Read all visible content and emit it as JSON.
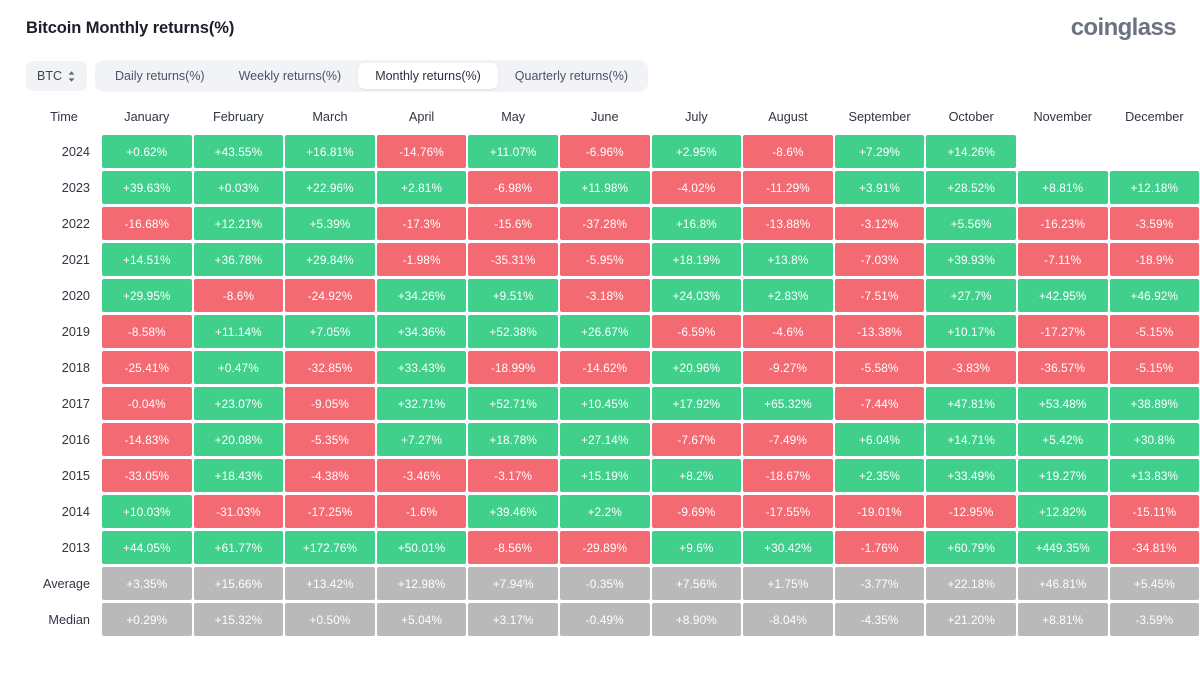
{
  "header": {
    "title": "Bitcoin Monthly returns(%)",
    "brand": "coinglass"
  },
  "controls": {
    "asset": "BTC",
    "asset_icon": "chevron-up-down-icon",
    "tabs": [
      {
        "label": "Daily returns(%)",
        "active": false
      },
      {
        "label": "Weekly returns(%)",
        "active": false
      },
      {
        "label": "Monthly returns(%)",
        "active": true
      },
      {
        "label": "Quarterly returns(%)",
        "active": false
      }
    ]
  },
  "colors": {
    "positive": "#41cf8c",
    "negative": "#f46a72",
    "statistic": "#b9b9b9",
    "tab_bar": "#f1f3f7",
    "text_dark": "#2f3542"
  },
  "table": {
    "columns": [
      "Time",
      "January",
      "February",
      "March",
      "April",
      "May",
      "June",
      "July",
      "August",
      "September",
      "October",
      "November",
      "December"
    ],
    "rows": [
      {
        "label": "2024",
        "type": "year",
        "values": [
          "+0.62%",
          "+43.55%",
          "+16.81%",
          "-14.76%",
          "+11.07%",
          "-6.96%",
          "+2.95%",
          "-8.6%",
          "+7.29%",
          "+14.26%",
          "",
          ""
        ]
      },
      {
        "label": "2023",
        "type": "year",
        "values": [
          "+39.63%",
          "+0.03%",
          "+22.96%",
          "+2.81%",
          "-6.98%",
          "+11.98%",
          "-4.02%",
          "-11.29%",
          "+3.91%",
          "+28.52%",
          "+8.81%",
          "+12.18%"
        ]
      },
      {
        "label": "2022",
        "type": "year",
        "values": [
          "-16.68%",
          "+12.21%",
          "+5.39%",
          "-17.3%",
          "-15.6%",
          "-37.28%",
          "+16.8%",
          "-13.88%",
          "-3.12%",
          "+5.56%",
          "-16.23%",
          "-3.59%"
        ]
      },
      {
        "label": "2021",
        "type": "year",
        "values": [
          "+14.51%",
          "+36.78%",
          "+29.84%",
          "-1.98%",
          "-35.31%",
          "-5.95%",
          "+18.19%",
          "+13.8%",
          "-7.03%",
          "+39.93%",
          "-7.11%",
          "-18.9%"
        ]
      },
      {
        "label": "2020",
        "type": "year",
        "values": [
          "+29.95%",
          "-8.6%",
          "-24.92%",
          "+34.26%",
          "+9.51%",
          "-3.18%",
          "+24.03%",
          "+2.83%",
          "-7.51%",
          "+27.7%",
          "+42.95%",
          "+46.92%"
        ]
      },
      {
        "label": "2019",
        "type": "year",
        "values": [
          "-8.58%",
          "+11.14%",
          "+7.05%",
          "+34.36%",
          "+52.38%",
          "+26.67%",
          "-6.59%",
          "-4.6%",
          "-13.38%",
          "+10.17%",
          "-17.27%",
          "-5.15%"
        ]
      },
      {
        "label": "2018",
        "type": "year",
        "values": [
          "-25.41%",
          "+0.47%",
          "-32.85%",
          "+33.43%",
          "-18.99%",
          "-14.62%",
          "+20.96%",
          "-9.27%",
          "-5.58%",
          "-3.83%",
          "-36.57%",
          "-5.15%"
        ]
      },
      {
        "label": "2017",
        "type": "year",
        "values": [
          "-0.04%",
          "+23.07%",
          "-9.05%",
          "+32.71%",
          "+52.71%",
          "+10.45%",
          "+17.92%",
          "+65.32%",
          "-7.44%",
          "+47.81%",
          "+53.48%",
          "+38.89%"
        ]
      },
      {
        "label": "2016",
        "type": "year",
        "values": [
          "-14.83%",
          "+20.08%",
          "-5.35%",
          "+7.27%",
          "+18.78%",
          "+27.14%",
          "-7.67%",
          "-7.49%",
          "+6.04%",
          "+14.71%",
          "+5.42%",
          "+30.8%"
        ]
      },
      {
        "label": "2015",
        "type": "year",
        "values": [
          "-33.05%",
          "+18.43%",
          "-4.38%",
          "-3.46%",
          "-3.17%",
          "+15.19%",
          "+8.2%",
          "-18.67%",
          "+2.35%",
          "+33.49%",
          "+19.27%",
          "+13.83%"
        ]
      },
      {
        "label": "2014",
        "type": "year",
        "values": [
          "+10.03%",
          "-31.03%",
          "-17.25%",
          "-1.6%",
          "+39.46%",
          "+2.2%",
          "-9.69%",
          "-17.55%",
          "-19.01%",
          "-12.95%",
          "+12.82%",
          "-15.11%"
        ]
      },
      {
        "label": "2013",
        "type": "year",
        "values": [
          "+44.05%",
          "+61.77%",
          "+172.76%",
          "+50.01%",
          "-8.56%",
          "-29.89%",
          "+9.6%",
          "+30.42%",
          "-1.76%",
          "+60.79%",
          "+449.35%",
          "-34.81%"
        ]
      },
      {
        "label": "Average",
        "type": "stat",
        "values": [
          "+3.35%",
          "+15.66%",
          "+13.42%",
          "+12.98%",
          "+7.94%",
          "-0.35%",
          "+7.56%",
          "+1.75%",
          "-3.77%",
          "+22.18%",
          "+46.81%",
          "+5.45%"
        ]
      },
      {
        "label": "Median",
        "type": "stat",
        "values": [
          "+0.29%",
          "+15.32%",
          "+0.50%",
          "+5.04%",
          "+3.17%",
          "-0.49%",
          "+8.90%",
          "-8.04%",
          "-4.35%",
          "+21.20%",
          "+8.81%",
          "-3.59%"
        ]
      }
    ]
  },
  "chart_data": {
    "type": "heatmap",
    "title": "Bitcoin Monthly returns(%)",
    "xlabel": "",
    "ylabel": "Time",
    "x_categories": [
      "January",
      "February",
      "March",
      "April",
      "May",
      "June",
      "July",
      "August",
      "September",
      "October",
      "November",
      "December"
    ],
    "y_categories": [
      "2024",
      "2023",
      "2022",
      "2021",
      "2020",
      "2019",
      "2018",
      "2017",
      "2016",
      "2015",
      "2014",
      "2013",
      "Average",
      "Median"
    ],
    "unit": "percent",
    "legend": "green = positive return, red = negative return, grey = summary statistic",
    "grid": false,
    "values": [
      [
        0.62,
        43.55,
        16.81,
        -14.76,
        11.07,
        -6.96,
        2.95,
        -8.6,
        7.29,
        14.26,
        null,
        null
      ],
      [
        39.63,
        0.03,
        22.96,
        2.81,
        -6.98,
        11.98,
        -4.02,
        -11.29,
        3.91,
        28.52,
        8.81,
        12.18
      ],
      [
        -16.68,
        12.21,
        5.39,
        -17.3,
        -15.6,
        -37.28,
        16.8,
        -13.88,
        -3.12,
        5.56,
        -16.23,
        -3.59
      ],
      [
        14.51,
        36.78,
        29.84,
        -1.98,
        -35.31,
        -5.95,
        18.19,
        13.8,
        -7.03,
        39.93,
        -7.11,
        -18.9
      ],
      [
        29.95,
        -8.6,
        -24.92,
        34.26,
        9.51,
        -3.18,
        24.03,
        2.83,
        -7.51,
        27.7,
        42.95,
        46.92
      ],
      [
        -8.58,
        11.14,
        7.05,
        34.36,
        52.38,
        26.67,
        -6.59,
        -4.6,
        -13.38,
        10.17,
        -17.27,
        -5.15
      ],
      [
        -25.41,
        0.47,
        -32.85,
        33.43,
        -18.99,
        -14.62,
        20.96,
        -9.27,
        -5.58,
        -3.83,
        -36.57,
        -5.15
      ],
      [
        -0.04,
        23.07,
        -9.05,
        32.71,
        52.71,
        10.45,
        17.92,
        65.32,
        -7.44,
        47.81,
        53.48,
        38.89
      ],
      [
        -14.83,
        20.08,
        -5.35,
        7.27,
        18.78,
        27.14,
        -7.67,
        -7.49,
        6.04,
        14.71,
        5.42,
        30.8
      ],
      [
        -33.05,
        18.43,
        -4.38,
        -3.46,
        -3.17,
        15.19,
        8.2,
        -18.67,
        2.35,
        33.49,
        19.27,
        13.83
      ],
      [
        10.03,
        -31.03,
        -17.25,
        -1.6,
        39.46,
        2.2,
        -9.69,
        -17.55,
        -19.01,
        -12.95,
        12.82,
        -15.11
      ],
      [
        44.05,
        61.77,
        172.76,
        50.01,
        -8.56,
        -29.89,
        9.6,
        30.42,
        -1.76,
        60.79,
        449.35,
        -34.81
      ],
      [
        3.35,
        15.66,
        13.42,
        12.98,
        7.94,
        -0.35,
        7.56,
        1.75,
        -3.77,
        22.18,
        46.81,
        5.45
      ],
      [
        0.29,
        15.32,
        0.5,
        5.04,
        3.17,
        -0.49,
        8.9,
        -8.04,
        -4.35,
        21.2,
        8.81,
        -3.59
      ]
    ]
  }
}
